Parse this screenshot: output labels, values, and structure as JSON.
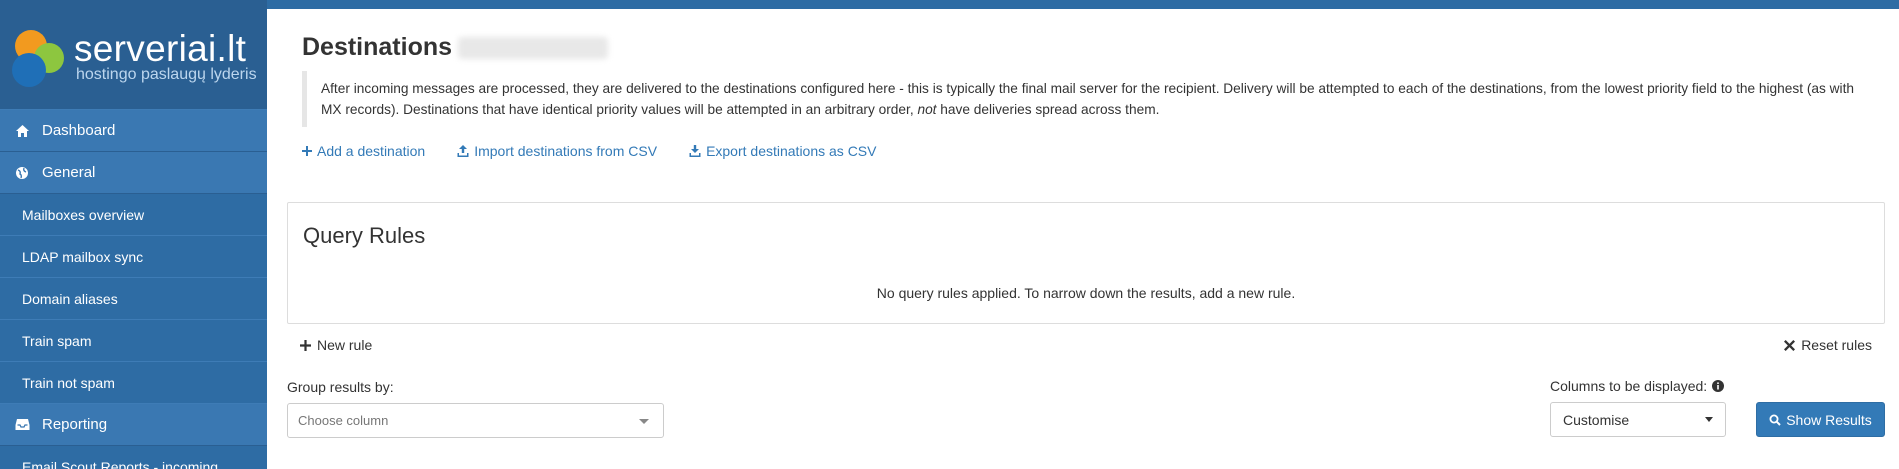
{
  "brand": {
    "title": "serveriai.lt",
    "subtitle": "hostingo paslaugų lyderis"
  },
  "sidebar": {
    "items": [
      {
        "label": "Dashboard",
        "icon": "home-icon",
        "type": "top"
      },
      {
        "label": "General",
        "icon": "globe-icon",
        "type": "top"
      },
      {
        "label": "Mailboxes overview",
        "type": "sub"
      },
      {
        "label": "LDAP mailbox sync",
        "type": "sub"
      },
      {
        "label": "Domain aliases",
        "type": "sub"
      },
      {
        "label": "Train spam",
        "type": "sub"
      },
      {
        "label": "Train not spam",
        "type": "sub"
      },
      {
        "label": "Reporting",
        "icon": "inbox-icon",
        "type": "top"
      },
      {
        "label": "Email Scout Reports - incoming",
        "type": "sub"
      }
    ]
  },
  "page": {
    "title": "Destinations",
    "description_part1": "After incoming messages are processed, they are delivered to the destinations configured here - this is typically the final mail server for the recipient. Delivery will be attempted to each of the destinations, from the lowest priority field to the highest (as with MX records). Destinations that have identical priority values will be attempted in an arbitrary order, ",
    "description_em": "not",
    "description_part2": " have deliveries spread across them."
  },
  "actions": {
    "add": "Add a destination",
    "import": "Import destinations from CSV",
    "export": "Export destinations as CSV"
  },
  "query": {
    "title": "Query Rules",
    "empty": "No query rules applied. To narrow down the results, add a new rule.",
    "new_rule": "New rule",
    "reset_rules": "Reset rules"
  },
  "filters": {
    "group_label": "Group results by:",
    "group_placeholder": "Choose column",
    "columns_label": "Columns to be displayed:",
    "columns_value": "Customise",
    "show_button": "Show Results"
  },
  "colors": {
    "sidebar": "#2e6ca4",
    "sidebar_active": "#3a78b2",
    "link": "#337ab7",
    "primary_button": "#337ab7"
  }
}
